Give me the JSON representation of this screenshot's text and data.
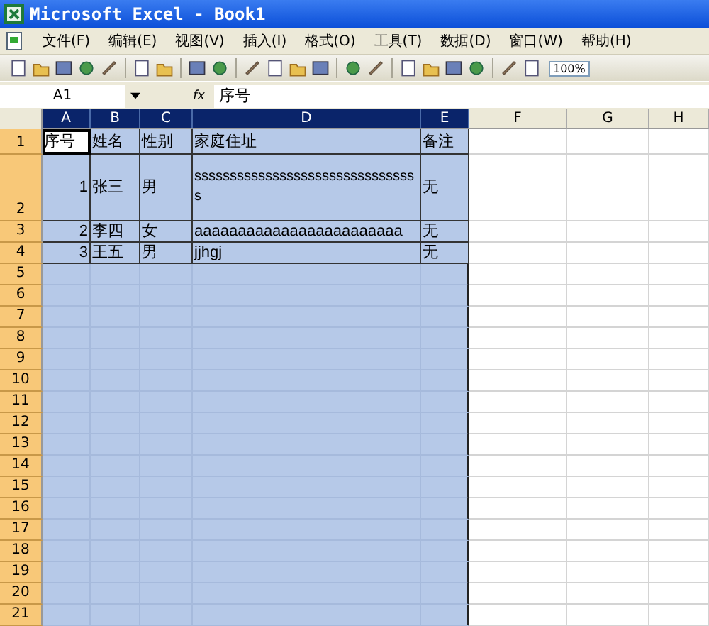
{
  "window": {
    "title": "Microsoft Excel - Book1"
  },
  "menu": [
    {
      "label": "文件(F)"
    },
    {
      "label": "编辑(E)"
    },
    {
      "label": "视图(V)"
    },
    {
      "label": "插入(I)"
    },
    {
      "label": "格式(O)"
    },
    {
      "label": "工具(T)"
    },
    {
      "label": "数据(D)"
    },
    {
      "label": "窗口(W)"
    },
    {
      "label": "帮助(H)"
    }
  ],
  "toolbar": {
    "zoom": "100%"
  },
  "formula_bar": {
    "name_box": "A1",
    "fx": "fx",
    "formula": "序号"
  },
  "columns": [
    {
      "label": "A",
      "selected": true
    },
    {
      "label": "B",
      "selected": true
    },
    {
      "label": "C",
      "selected": true
    },
    {
      "label": "D",
      "selected": true
    },
    {
      "label": "E",
      "selected": true
    },
    {
      "label": "F",
      "selected": false
    },
    {
      "label": "G",
      "selected": false
    },
    {
      "label": "H",
      "selected": false
    }
  ],
  "rows": [
    {
      "header": "1",
      "selected": true,
      "cells": [
        {
          "text": "序号",
          "kind": "text",
          "active": true
        },
        {
          "text": "姓名",
          "kind": "text",
          "active": false
        },
        {
          "text": "性别",
          "kind": "text",
          "active": false
        },
        {
          "text": "家庭住址",
          "kind": "text",
          "active": false
        },
        {
          "text": "备注",
          "kind": "text",
          "active": false
        }
      ]
    },
    {
      "header": "2",
      "selected": true,
      "cells": [
        {
          "text": "1",
          "kind": "number",
          "active": false
        },
        {
          "text": "张三",
          "kind": "text",
          "active": false
        },
        {
          "text": "男",
          "kind": "text",
          "active": false
        },
        {
          "text": "ssssssssssssssssssssssssssssssss",
          "kind": "wrap",
          "active": false
        },
        {
          "text": "无",
          "kind": "text",
          "active": false
        }
      ]
    },
    {
      "header": "3",
      "selected": true,
      "cells": [
        {
          "text": "2",
          "kind": "number",
          "active": false
        },
        {
          "text": "李四",
          "kind": "text",
          "active": false
        },
        {
          "text": "女",
          "kind": "text",
          "active": false
        },
        {
          "text": "aaaaaaaaaaaaaaaaaaaaaaaa",
          "kind": "text",
          "active": false
        },
        {
          "text": "无",
          "kind": "text",
          "active": false
        }
      ]
    },
    {
      "header": "4",
      "selected": true,
      "cells": [
        {
          "text": "3",
          "kind": "number",
          "active": false
        },
        {
          "text": "王五",
          "kind": "text",
          "active": false
        },
        {
          "text": "男",
          "kind": "text",
          "active": false
        },
        {
          "text": "jjhgj",
          "kind": "text",
          "active": false
        },
        {
          "text": "无",
          "kind": "text",
          "active": false
        }
      ]
    },
    {
      "header": "5",
      "selected": true
    },
    {
      "header": "6",
      "selected": true
    },
    {
      "header": "7",
      "selected": true
    },
    {
      "header": "8",
      "selected": true
    },
    {
      "header": "9",
      "selected": true
    },
    {
      "header": "10",
      "selected": true
    },
    {
      "header": "11",
      "selected": true
    },
    {
      "header": "12",
      "selected": true
    },
    {
      "header": "13",
      "selected": true
    },
    {
      "header": "14",
      "selected": true
    },
    {
      "header": "15",
      "selected": true
    },
    {
      "header": "16",
      "selected": true
    },
    {
      "header": "17",
      "selected": true
    },
    {
      "header": "18",
      "selected": true
    },
    {
      "header": "19",
      "selected": true
    },
    {
      "header": "20",
      "selected": true
    },
    {
      "header": "21",
      "selected": true
    }
  ]
}
